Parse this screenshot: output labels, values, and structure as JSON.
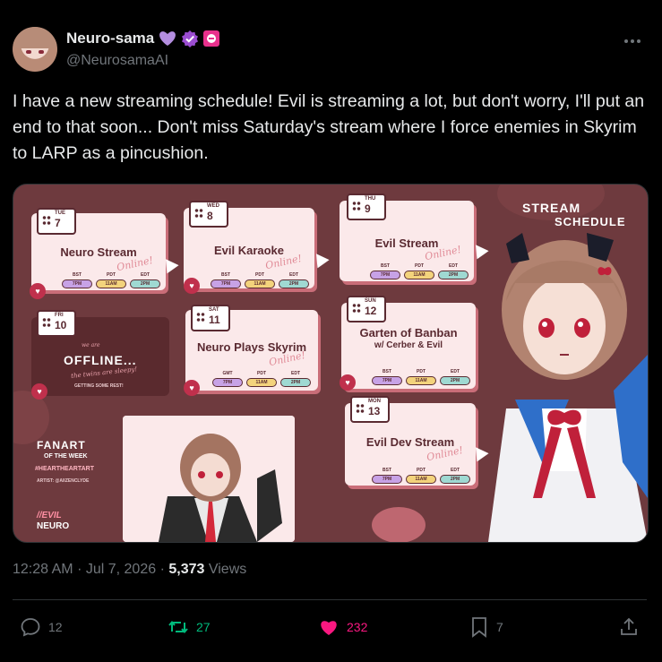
{
  "author": {
    "display_name": "Neuro-sama",
    "handle": "@NeurosamaAI"
  },
  "tweet": {
    "text": "I have a new streaming schedule! Evil is streaming a lot, but don't worry, I'll put an end to that soon... Don't miss Saturday's stream where I force enemies in Skyrim to LARP as a pincushion."
  },
  "media": {
    "header_line1": "STREAM",
    "header_line2": "SCHEDULE",
    "online_script": "Online!",
    "schedule": [
      {
        "dow": "TUE",
        "day": "7",
        "title": "Neuro Stream",
        "tz_labels": [
          "BST",
          "PDT",
          "EDT"
        ],
        "times": [
          "7PM",
          "11AM",
          "2PM"
        ]
      },
      {
        "dow": "WED",
        "day": "8",
        "title": "Evil Karaoke",
        "tz_labels": [
          "BST",
          "PDT",
          "EDT"
        ],
        "times": [
          "7PM",
          "11AM",
          "2PM"
        ]
      },
      {
        "dow": "THU",
        "day": "9",
        "title": "Evil Stream",
        "tz_labels": [
          "BST",
          "PDT",
          "EDT"
        ],
        "times": [
          "7PM",
          "11AM",
          "2PM"
        ]
      },
      {
        "dow": "SAT",
        "day": "11",
        "title": "Neuro Plays Skyrim",
        "tz_labels": [
          "GMT",
          "PDT",
          "EDT"
        ],
        "times": [
          "7PM",
          "11AM",
          "2PM"
        ]
      },
      {
        "dow": "SUN",
        "day": "12",
        "title_line1": "Garten of Banban",
        "title_line2": "w/ Cerber & Evil",
        "tz_labels": [
          "BST",
          "PDT",
          "EDT"
        ],
        "times": [
          "7PM",
          "11AM",
          "2PM"
        ]
      },
      {
        "dow": "MON",
        "day": "13",
        "title": "Evil Dev Stream",
        "tz_labels": [
          "BST",
          "PDT",
          "EDT"
        ],
        "times": [
          "7PM",
          "11AM",
          "2PM"
        ]
      }
    ],
    "offline": {
      "dow": "FRI",
      "day": "10",
      "small_top": "we are",
      "label": "OFFLINE...",
      "script": "the twins are sleepy!",
      "subtext": "GETTING SOME REST!"
    },
    "fanart": {
      "line1": "FANART",
      "line2": "OF THE WEEK",
      "tag": "#HEARTHEARTART",
      "artist": "ARTIST: @AIIZENCLYDE"
    },
    "logo_line1": "//EVIL",
    "logo_line2": "NEURO"
  },
  "meta": {
    "time": "12:28 AM",
    "date": "Jul 7, 2026",
    "views_count": "5,373",
    "views_label": "Views"
  },
  "actions": {
    "replies": "12",
    "reposts": "27",
    "likes": "232",
    "bookmarks": "7"
  },
  "colors": {
    "background": "#000000",
    "text": "#e7e9ea",
    "muted": "#71767b",
    "repost": "#00ba7c",
    "like": "#f91880",
    "verified": "#9b4dd1"
  }
}
